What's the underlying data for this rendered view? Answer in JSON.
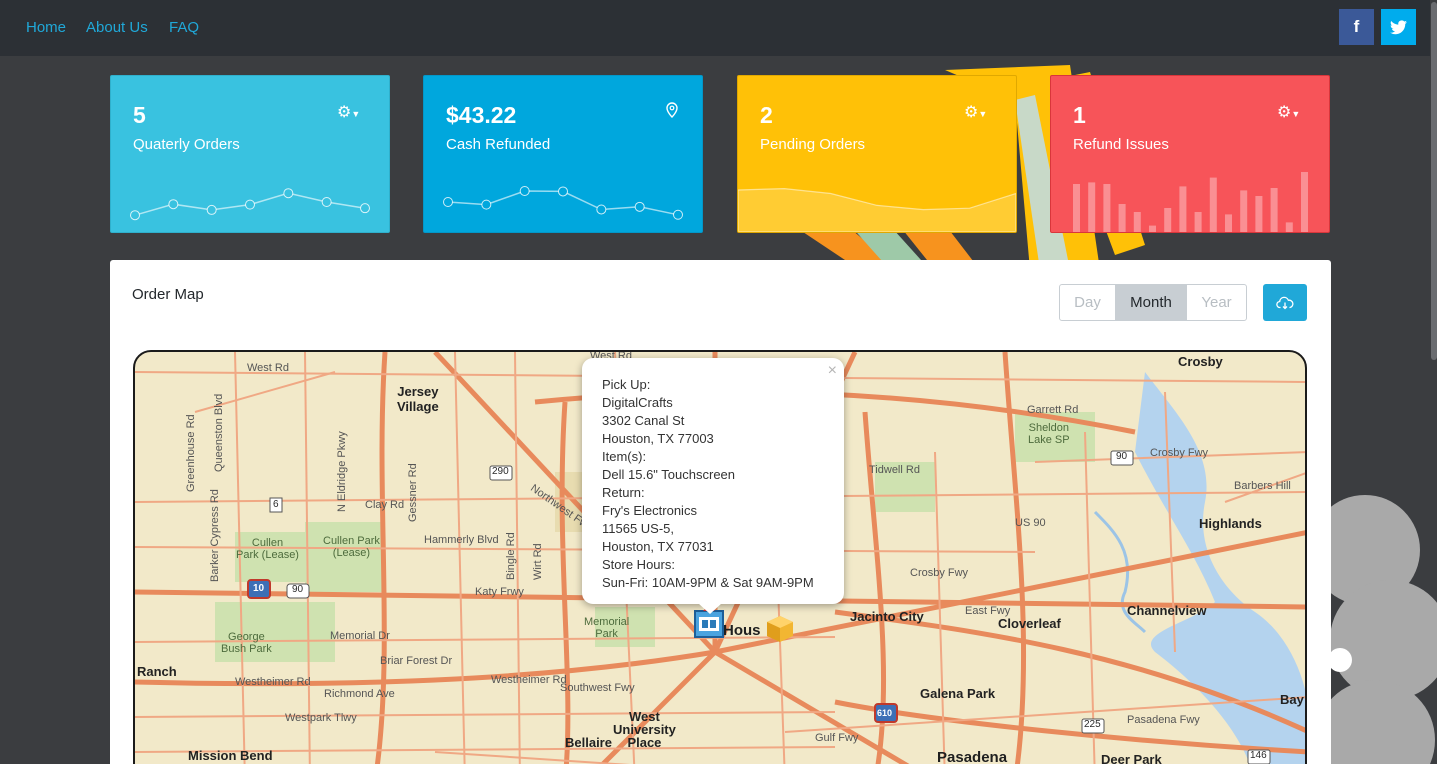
{
  "nav": {
    "links": [
      "Home",
      "About Us",
      "FAQ"
    ],
    "facebook_icon": "f",
    "twitter_icon": "twitter-bird"
  },
  "cards": [
    {
      "value": "5",
      "label": "Quaterly Orders",
      "control_icon": "gear-icon",
      "color": "#39c2e0",
      "sparkline": [
        20,
        45,
        32,
        44,
        70,
        50,
        36
      ]
    },
    {
      "value": "$43.22",
      "label": "Cash Refunded",
      "control_icon": "location-pin-icon",
      "color": "#00a7dd",
      "sparkline": [
        50,
        44,
        75,
        74,
        33,
        39,
        21
      ]
    },
    {
      "value": "2",
      "label": "Pending Orders",
      "control_icon": "gear-icon",
      "color": "#ffc107",
      "sparkline": [
        60,
        62,
        55,
        38,
        32,
        34,
        55
      ]
    },
    {
      "value": "1",
      "label": "Refund Issues",
      "control_icon": "gear-icon",
      "color": "#f75459",
      "bars": [
        60,
        62,
        60,
        35,
        25,
        8,
        30,
        57,
        25,
        68,
        22,
        52,
        45,
        55,
        12,
        75
      ]
    }
  ],
  "panel": {
    "title": "Order Map",
    "periods": [
      "Day",
      "Month",
      "Year"
    ],
    "active_period": "Month",
    "download_icon": "cloud-download-icon"
  },
  "map": {
    "popup": {
      "lines": [
        "Pick Up:",
        "DigitalCrafts",
        "3302 Canal St",
        "Houston, TX 77003",
        "Item(s):",
        "Dell 15.6\" Touchscreen",
        "Return:",
        "Fry's Electronics",
        "11565 US-5,",
        "Houston, TX 77031",
        "Store Hours:",
        "Sun-Fri: 10AM-9PM & Sat 9AM-9PM"
      ],
      "close": "×"
    },
    "labels": {
      "jersey_village": "Jersey\nVillage",
      "crosby": "Crosby",
      "garrett_rd": "Garrett Rd",
      "sheldon_lake": "Sheldon\nLake SP",
      "highlands": "Highlands",
      "barbers_hill": "Barbers Hill",
      "channelview": "Channelview",
      "cloverleaf": "Cloverleaf",
      "jacinto_city": "Jacinto City",
      "galena_park": "Galena Park",
      "pasadena": "Pasadena",
      "deer_park": "Deer Park",
      "bellaire": "Bellaire",
      "west_university": "West\nUniversity\nPlace",
      "mission_bend": "Mission Bend",
      "ranch": "Ranch",
      "george_bush_park": "George\nBush Park",
      "cullen_park_lease_1": "Cullen\nPark (Lease)",
      "cullen_park_lease_2": "Cullen Park\n(Lease)",
      "memorial_park": "Memorial\nPark",
      "houston": "Hous",
      "tidwell_rd": "Tidwell Rd",
      "clay_rd": "Clay Rd",
      "hammerly_blvd": "Hammerly Blvd",
      "katy_frwy": "Katy Frwy",
      "westheimer_rd_1": "Westheimer Rd",
      "westheimer_rd_2": "Westheimer Rd",
      "richmond_ave": "Richmond Ave",
      "westpark_tlwy": "Westpark Tlwy",
      "briar_forest_dr": "Briar Forest Dr",
      "memorial_dr": "Memorial Dr",
      "southwest_fwy": "Southwest Fwy",
      "pasadena_fwy": "Pasadena Fwy",
      "gulf_fwy": "Gulf Fwy",
      "east_fwy": "East Fwy",
      "crosby_fwy_1": "Crosby Fwy",
      "crosby_fwy_2": "Crosby Fwy",
      "us_90": "US 90",
      "baytown": "Bay",
      "west_rd_1": "West Rd",
      "west_rd_2": "West Rd",
      "barker_cypress": "Barker Cypress Rd",
      "greenhouse_rd": "Greenhouse Rd",
      "queenston_blvd": "Queenston Blvd",
      "eldridge_pkwy": "N Eldridge Pkwy",
      "gessner": "Gessner Rd",
      "northwest_fwy": "Northwest Fwy",
      "bingle_rd": "Bingle Rd",
      "wirt_rd": "Wirt Rd",
      "highway_10": "10",
      "highway_90": "90",
      "highway_6": "6",
      "highway_290": "290",
      "highway_225": "225",
      "highway_610": "610",
      "highway_146": "146",
      "highway_90b": "90"
    }
  }
}
